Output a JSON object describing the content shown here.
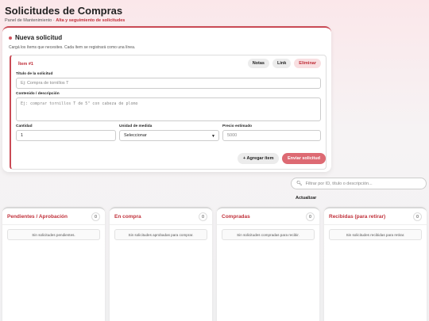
{
  "header": {
    "title": "Solicitudes de Compras",
    "subtitle_prefix": "Panel de Mantenimiento",
    "subtitle_separator": "·",
    "subtitle_accent": "Alta y seguimiento de solicitudes"
  },
  "new_request": {
    "title": "Nueva solicitud",
    "hint": "Cargá los ítems que necesites. Cada ítem se registrará como una línea.",
    "item": {
      "label": "Ítem #1",
      "actions": {
        "notes": "Notas",
        "link": "Link",
        "delete": "Eliminar"
      },
      "title_label": "Título de la solicitud",
      "title_placeholder": "Ej: Compra de tornillos T",
      "content_label": "Contenido / descripción",
      "content_placeholder": "Ej: comprar tornillos T de 5\" con cabeza de plomo",
      "quantity_label": "Cantidad",
      "quantity_value": "1",
      "unit_label": "Unidad de medida",
      "unit_value": "Seleccionar",
      "price_label": "Precio estimado",
      "price_placeholder": "5000"
    },
    "add_item": "+ Agregar ítem",
    "send": "Enviar solicitud"
  },
  "filter": {
    "placeholder": "Filtrar por ID, título o descripción...",
    "refresh": "Actualizar",
    "icon": "search-icon"
  },
  "columns": [
    {
      "title": "Pendientes / Aprobación",
      "count": "0",
      "empty": "Sin solicitudes pendientes."
    },
    {
      "title": "En compra",
      "count": "0",
      "empty": "Sin solicitudes aprobadas para comprar."
    },
    {
      "title": "Compradas",
      "count": "0",
      "empty": "Sin solicitudes compradas para recibir."
    },
    {
      "title": "Recibidas (para retirar)",
      "count": "0",
      "empty": "Sin solicitudes recibidas para retirar."
    }
  ],
  "colors": {
    "accent": "#c0303a",
    "send_button": "#dd6a73"
  }
}
